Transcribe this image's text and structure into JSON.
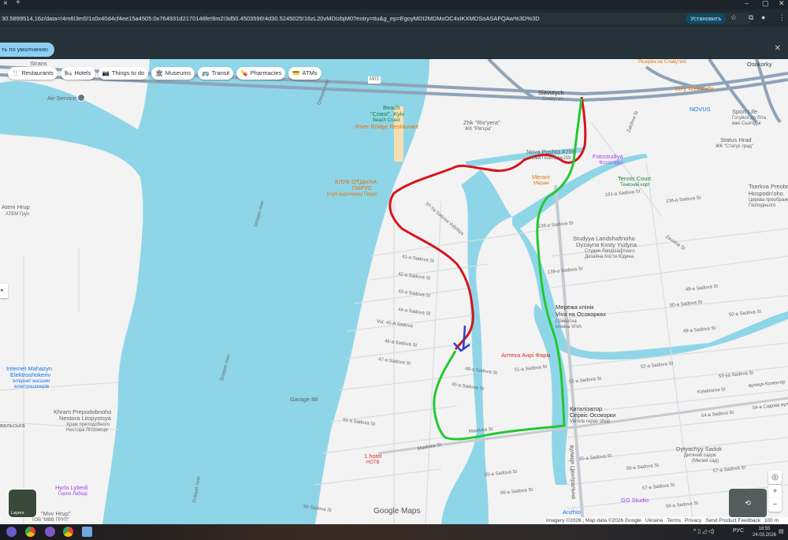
{
  "browser": {
    "url": "30.5899514,16z/data=!4m6!3m5!1s0x40d4cf4ee15a4505:0x764931d2170146fe!8m2!3d50.4503596!4d30.5245025!16zL20vMDIzbjM0?entry=ttu&g_ep=EgoyMDI2MDMxOC4xIKXMDSoASAFQAw%3D%3D",
    "install_label": "Установить",
    "infobar_button": "ть по умолчанию"
  },
  "chips": [
    {
      "icon": "🍴",
      "label": "Restaurants"
    },
    {
      "icon": "🛏",
      "label": "Hotels"
    },
    {
      "icon": "📷",
      "label": "Things to do"
    },
    {
      "icon": "🏛",
      "label": "Museums"
    },
    {
      "icon": "🚌",
      "label": "Transit"
    },
    {
      "icon": "💊",
      "label": "Pharmacies"
    },
    {
      "icon": "💳",
      "label": "ATMs"
    }
  ],
  "places": {
    "strans": "Strans",
    "air_service": "Air-Service",
    "atem": "Atem Hrup",
    "atem_ua": "АТЕМ Груп",
    "internet": "Internet Mahazyn",
    "internet2": "Elektroshokeriv",
    "internet_ua": "Інтернет магазин",
    "internet_ua2": "електрошокерів",
    "khram": "Khram Prepodobnoho",
    "khram2": "Nestora Litopystsya",
    "khram_ua": "Храм преподобного",
    "khram_ua2": "Нестора Літописця",
    "valska": "вальська",
    "hyrlo": "Hyrlo Lybedi",
    "hyrlo_ua": "Гирло Либеді",
    "mvv": "\"Mvv Hrup\"",
    "mvv_ua": "ТОВ \"МВВ ГРУП\"",
    "beach": "Beach",
    "beach2": "\"Coast\", Kyiv",
    "beach_ua": "Beach Coast",
    "river_bridge": "River Bridge Restaurant",
    "klub": "КЛУБ ОТДЫХА",
    "klub2": "ПАРУС",
    "klub_ua": "Клуб відпочинку Парус",
    "zhk": "Zhk \"Riv'yera\"",
    "zhk_ua": "ЖК \"Рів'єра\"",
    "slavutych": "Slavutych",
    "slavutych_ua": "Славутич",
    "nova": "Nova Poshta #259",
    "nova_ua": "Нова Пошта №259",
    "merani": "Merani",
    "merani_ua": "Мерані",
    "foto": "Fotostudiya",
    "foto_ua": "Фотостудія",
    "tennis": "Tennis Court",
    "tennis_ua": "Тенісний корт",
    "very_well": "Very Well Cafe",
    "novus": "NOVUS",
    "sport": "Sport Life",
    "sport_ua": "Готуйся до Літа",
    "sport_ua2": "вже Сьогодні",
    "status": "Status Hrad",
    "status_ua": "ЖК \"Статус град\"",
    "osokorky": "Osokorky",
    "tserkva": "Tserkva Preobra",
    "tserkva2": "Hospodn'oho",
    "tserkva_ua": "Церква преображення",
    "tserkva_ua2": "Господнього",
    "studiya": "Studyya Landshaftnoho",
    "studiya2": "Dyzayna Kosty Yudyna",
    "studiya_ua": "Студия Ландшафтного",
    "studiya_ua2": "Дизайна Кости Юдина",
    "viva": "Мережа клінік",
    "viva2": "Viva на Осокорках",
    "viva_ua": "Приватна",
    "viva_ua2": "клініка VIVA",
    "apteka": "Аптека Анрі Фарм",
    "kataliz": "Каталізатор",
    "kataliz2": "Сервіс Осокорки",
    "kataliz_ua": "Vehicle repair shop",
    "dytyachyy": "Dytyachyy Sadok",
    "dytyachyy_ua": "Дитячий садок",
    "dytyachyy_ua2": "(Милий сад)",
    "gg": "GG Studio",
    "anzhio": "Anzhio",
    "garage": "Garage 88",
    "hotel": "1 hotel",
    "hotel_ua": "НОТВ",
    "reserve": "Резерва на Славутичі"
  },
  "rivers": [
    "Dnieper river",
    "Dnieper river",
    "Dnieper river",
    "Dnieper river"
  ],
  "streets": [
    "191-a Sadova St",
    "136-a Sadova St",
    "136-a Sadova St",
    "139-a Sadova St",
    "49-a Sadova St",
    "49-a Sadova St",
    "50-a Sadova St",
    "50-a Sadova St",
    "51-a Sadova St",
    "52-a Sadova St",
    "53-ya Sadova St",
    "52-a Sadova St",
    "Kolektorna St",
    "вулиця Колектор",
    "54-a Sadova St",
    "54-a Садова вул",
    "55-a Sadova St",
    "56-a Sadova St",
    "57-a Sadova St",
    "58-a Sadova St",
    "Maslivka St",
    "Maslivka St",
    "Zaichna St",
    "Zavalna St",
    "41-a Sadova St",
    "42-a Sadova St",
    "43-a Sadova St",
    "44-a Sadova St",
    "46-a Sadova St",
    "47-a Sadova St",
    "48-a Sadova St",
    "45-a Sadova St",
    "51-a Sadova St",
    "99 Sadova St",
    "37-Ya Sadova Vulytsya",
    "вулиця Центральна",
    "55-a Sadova St",
    "56-a Sadova St",
    "57-a Sadova St",
    "Vul. 45-A Sadova"
  ],
  "map": {
    "layers_label": "Layers",
    "brand": "Google Maps",
    "footer": [
      "Imagery ©2026 , Map data ©2026 Google",
      "Ukraine",
      "Terms",
      "Privacy",
      "Send Product Feedback",
      "100 m"
    ],
    "highway_badge": "M03",
    "colors": {
      "water": "#8fd5e8",
      "route_red": "#d7141d",
      "route_green": "#22c832",
      "route_blue": "#2a3fd6"
    }
  },
  "taskbar": {
    "lang": "РУС",
    "time": "18:55",
    "date": "24.03.2026"
  }
}
